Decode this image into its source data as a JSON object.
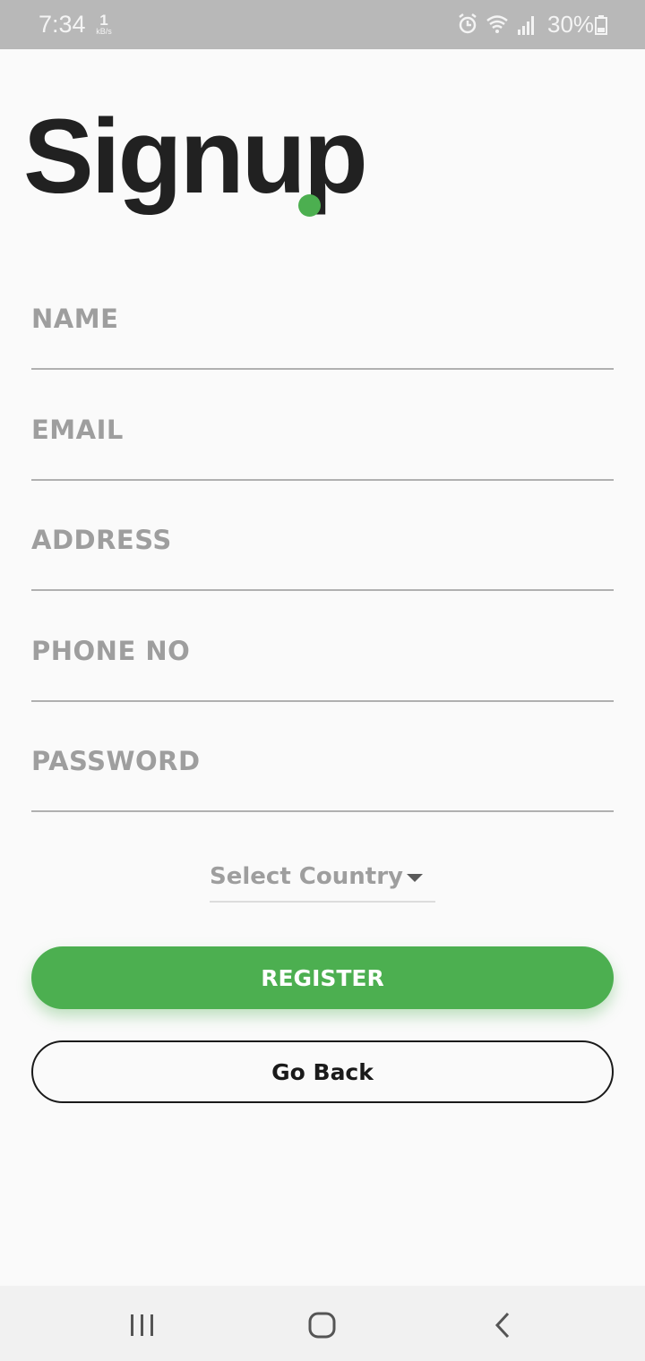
{
  "status_bar": {
    "time": "7:34",
    "net_speed_value": "1",
    "net_speed_unit": "kB/s",
    "battery": "30%",
    "icons": [
      "alarm-icon",
      "wifi-icon",
      "signal-icon",
      "battery-icon"
    ]
  },
  "title": "Signup",
  "accent_color": "#4caf50",
  "fields": {
    "name": {
      "placeholder": "NAME",
      "value": ""
    },
    "email": {
      "placeholder": "EMAIL",
      "value": ""
    },
    "address": {
      "placeholder": "ADDRESS",
      "value": ""
    },
    "phone": {
      "placeholder": "PHONE NO",
      "value": ""
    },
    "password": {
      "placeholder": "PASSWORD",
      "value": ""
    }
  },
  "country_select": {
    "selected": "Select Country"
  },
  "buttons": {
    "register": "REGISTER",
    "go_back": "Go Back"
  },
  "nav_bar": {
    "icons": [
      "recents-icon",
      "home-icon",
      "back-icon"
    ]
  }
}
